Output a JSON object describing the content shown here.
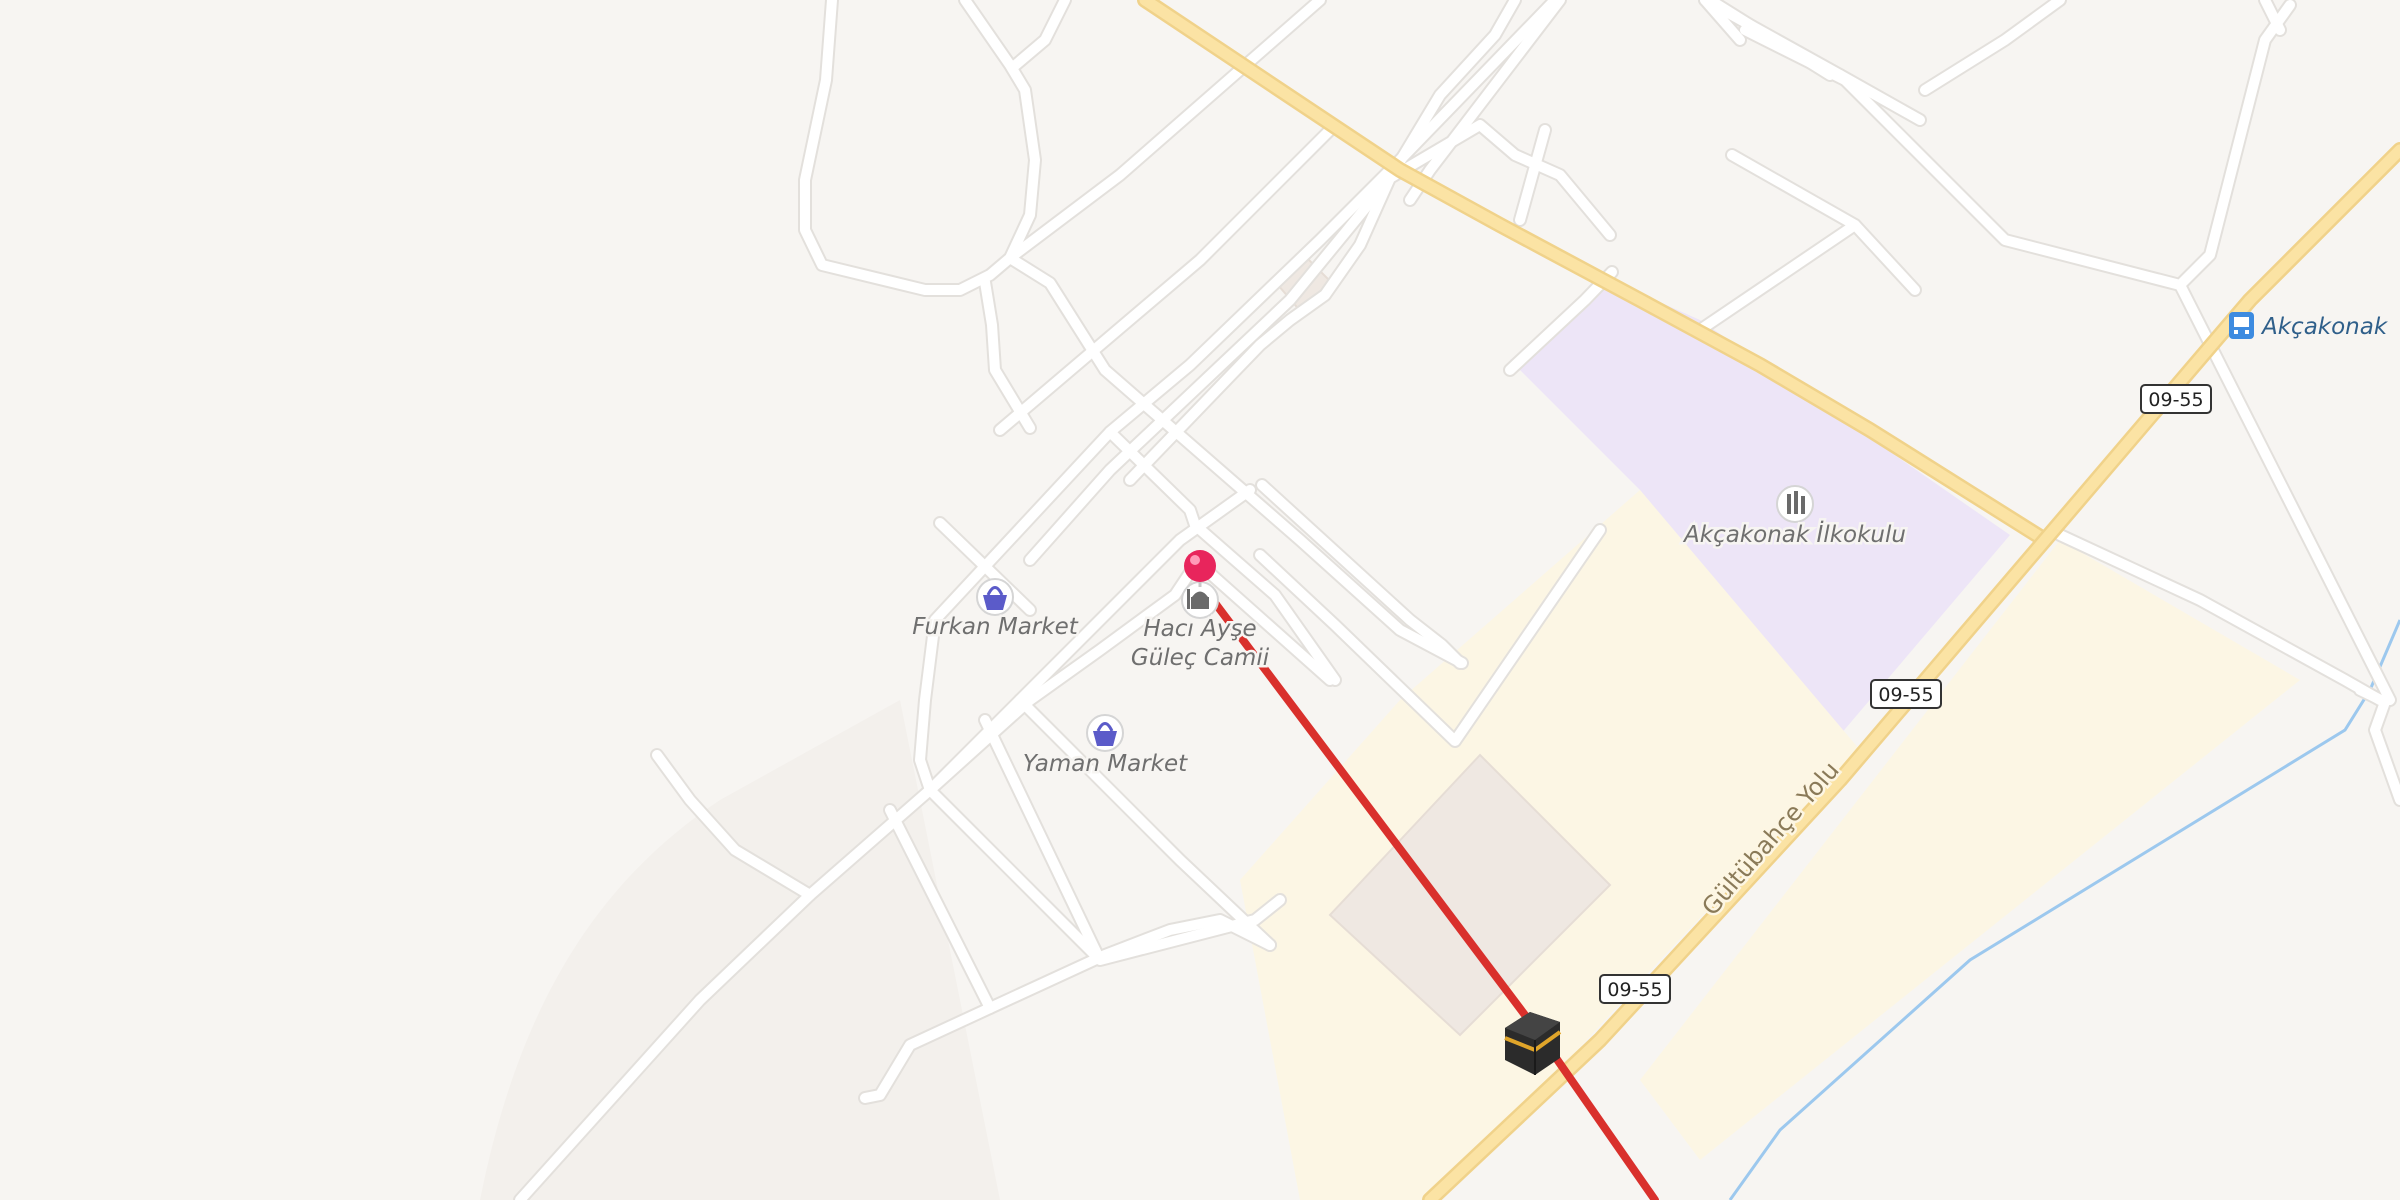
{
  "map": {
    "pois": [
      {
        "name": "Furkan Market",
        "icon": "shopping-basket-icon"
      },
      {
        "name": "Yaman Market",
        "icon": "shopping-basket-icon"
      },
      {
        "name_line1": "Hacı Ayşe",
        "name_line2": "Güleç Camii",
        "icon": "mosque-icon"
      },
      {
        "name": "Akçakonak İlkokulu",
        "icon": "school-icon"
      },
      {
        "name": "Akçakonak",
        "icon": "bus-stop-icon"
      }
    ],
    "road_label": "Gültübahçe Yolu",
    "route_shields": [
      "09-55",
      "09-55",
      "09-55"
    ],
    "colors": {
      "background": "#f7f5f2",
      "road": "#ffffff",
      "main_road": "#fbe3a4",
      "school_area": "#ede5f7",
      "residential_area": "#fcf6e4",
      "route_line": "#d9302c",
      "pin": "#e8255c",
      "water": "#9cc8ee"
    }
  }
}
